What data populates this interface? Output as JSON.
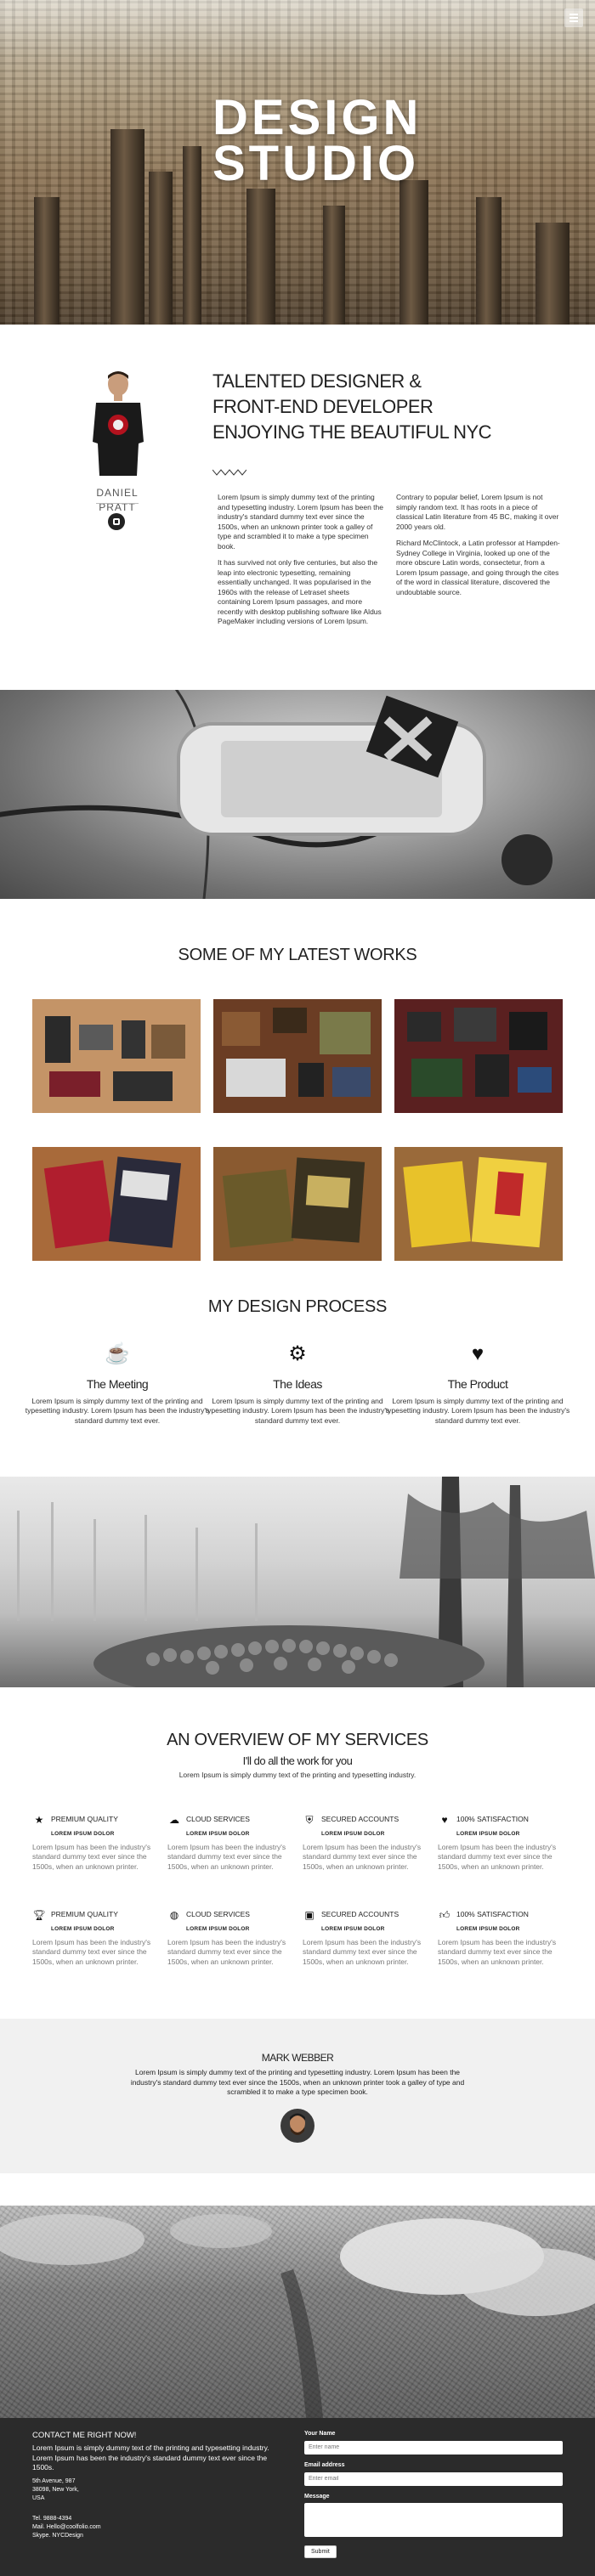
{
  "hero": {
    "title_line1": "DESIGN",
    "title_line2": "STUDIO",
    "menu_icon": "hamburger-menu-icon"
  },
  "about": {
    "name": "DANIEL PRATT",
    "heading_line1": "TALENTED DESIGNER &",
    "heading_line2": "FRONT-END DEVELOPER",
    "heading_line3": "ENJOYING THE BEAUTIFUL NYC",
    "col1_p1": "Lorem Ipsum is simply dummy text of the printing and typesetting industry. Lorem Ipsum has been the industry's standard dummy text ever since the 1500s, when an unknown printer took a galley of type and scrambled it to make a type specimen book.",
    "col1_p2": "It has survived not only five centuries, but also the leap into electronic typesetting, remaining essentially unchanged. It was popularised in the 1960s with the release of Letraset sheets containing Lorem Ipsum passages, and more recently with desktop publishing software like Aldus PageMaker including versions of Lorem Ipsum.",
    "col2_p1": "Contrary to popular belief, Lorem Ipsum is not simply random text. It has roots in a piece of classical Latin literature from 45 BC, making it over 2000 years old.",
    "col2_p2": "Richard McClintock, a Latin professor at Hampden-Sydney College in Virginia, looked up one of the more obscure Latin words, consectetur, from a Lorem Ipsum passage, and going through the cites of the word in classical literature, discovered the undoubtable source.",
    "social_icon": "dribbble-icon"
  },
  "works": {
    "title": "SOME OF MY LATEST WORKS"
  },
  "process": {
    "title": "MY DESIGN PROCESS",
    "items": [
      {
        "icon": "coffee-cup-icon",
        "title": "The Meeting",
        "text": "Lorem Ipsum is simply dummy text of the printing and typesetting industry. Lorem Ipsum has been the industry's standard dummy text ever."
      },
      {
        "icon": "gears-icon",
        "title": "The Ideas",
        "text": "Lorem Ipsum is simply dummy text of the printing and typesetting industry. Lorem Ipsum has been the industry's standard dummy text ever."
      },
      {
        "icon": "heart-icon",
        "title": "The Product",
        "text": "Lorem Ipsum is simply dummy text of the printing and typesetting industry. Lorem Ipsum has been the industry's standard dummy text ever."
      }
    ]
  },
  "services": {
    "title": "AN OVERVIEW OF MY SERVICES",
    "subtitle": "I'll do all the work for you",
    "intro": "Lorem Ipsum is simply dummy text of the printing and typesetting industry.",
    "items": [
      {
        "icon": "star-icon",
        "title": "PREMIUM QUALITY",
        "sub": "LOREM IPSUM DOLOR",
        "text": "Lorem Ipsum has been the industry's standard dummy text ever since the 1500s, when an unknown printer."
      },
      {
        "icon": "cloud-icon",
        "title": "CLOUD SERVICES",
        "sub": "LOREM IPSUM DOLOR",
        "text": "Lorem Ipsum has been the industry's standard dummy text ever since the 1500s, when an unknown printer."
      },
      {
        "icon": "shield-icon",
        "title": "SECURED ACCOUNTS",
        "sub": "LOREM IPSUM DOLOR",
        "text": "Lorem Ipsum has been the industry's standard dummy text ever since the 1500s, when an unknown printer."
      },
      {
        "icon": "heart-icon",
        "title": "100% SATISFACTION",
        "sub": "LOREM IPSUM DOLOR",
        "text": "Lorem Ipsum has been the industry's standard dummy text ever since the 1500s, when an unknown printer."
      },
      {
        "icon": "trophy-icon",
        "title": "PREMIUM QUALITY",
        "sub": "LOREM IPSUM DOLOR",
        "text": "Lorem Ipsum has been the industry's standard dummy text ever since the 1500s, when an unknown printer."
      },
      {
        "icon": "globe-icon",
        "title": "CLOUD SERVICES",
        "sub": "LOREM IPSUM DOLOR",
        "text": "Lorem Ipsum has been the industry's standard dummy text ever since the 1500s, when an unknown printer."
      },
      {
        "icon": "lock-icon",
        "title": "SECURED ACCOUNTS",
        "sub": "LOREM IPSUM DOLOR",
        "text": "Lorem Ipsum has been the industry's standard dummy text ever since the 1500s, when an unknown printer."
      },
      {
        "icon": "thumbs-up-icon",
        "title": "100% SATISFACTION",
        "sub": "LOREM IPSUM DOLOR",
        "text": "Lorem Ipsum has been the industry's standard dummy text ever since the 1500s, when an unknown printer."
      }
    ]
  },
  "testimonial": {
    "name": "MARK WEBBER",
    "text": "Lorem Ipsum is simply dummy text of the printing and typesetting industry. Lorem Ipsum has been the industry's standard dummy text ever since the 1500s, when an unknown printer took a galley of type and scrambled it to make a type specimen book."
  },
  "footer": {
    "heading": "CONTACT ME RIGHT NOW!",
    "intro": "Lorem Ipsum is simply dummy text of the printing and typesetting industry. Lorem Ipsum has been the industry's standard dummy text ever since the 1500s.",
    "address1": "5th Avenue, 987",
    "address2": "38098, New York,",
    "address3": "USA",
    "tel": "Tel. 9888-4394",
    "mail": "Mail. Hello@coolfolio.com",
    "skype": "Skype. NYCDesign",
    "name_label": "Your Name",
    "name_placeholder": "Enter name",
    "email_label": "Email address",
    "email_placeholder": "Enter email",
    "message_label": "Message",
    "submit_label": "Submit"
  }
}
